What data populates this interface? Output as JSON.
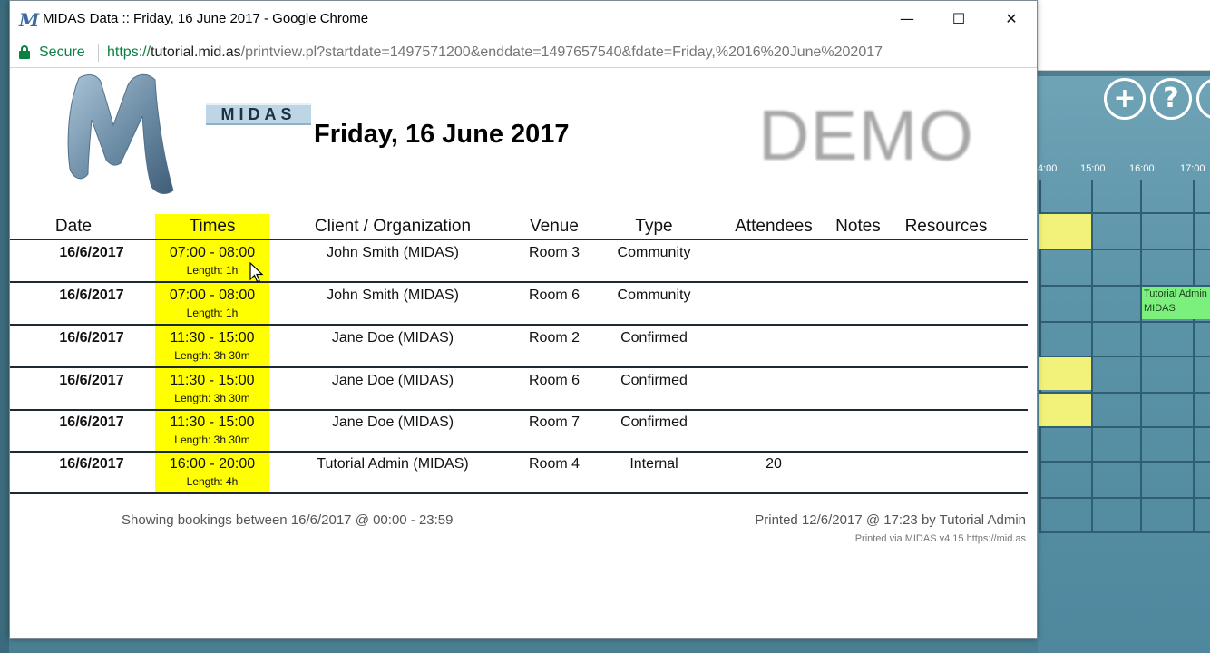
{
  "window": {
    "title": "MIDAS Data :: Friday, 16 June 2017 - Google Chrome",
    "controls": {
      "minimize": "—",
      "maximize": "☐",
      "close": "✕"
    }
  },
  "address_bar": {
    "security_label": "Secure",
    "url_scheme": "https://",
    "url_host": "tutorial.mid.as",
    "url_path": "/printview.pl?startdate=1497571200&enddate=1497657540&fdate=Friday,%2016%20June%202017"
  },
  "logo": {
    "text": "MIDAS"
  },
  "page": {
    "title": "Friday, 16 June 2017",
    "watermark": "DEMO"
  },
  "table": {
    "columns": [
      "Date",
      "Times",
      "Client / Organization",
      "Venue",
      "Type",
      "Attendees",
      "Notes",
      "Resources"
    ],
    "rows": [
      {
        "date": "16/6/2017",
        "time": "07:00 - 08:00",
        "length": "Length: 1h",
        "client": "John Smith (MIDAS)",
        "venue": "Room 3",
        "type": "Community",
        "attendees": "",
        "notes": "",
        "resources": ""
      },
      {
        "date": "16/6/2017",
        "time": "07:00 - 08:00",
        "length": "Length: 1h",
        "client": "John Smith (MIDAS)",
        "venue": "Room 6",
        "type": "Community",
        "attendees": "",
        "notes": "",
        "resources": ""
      },
      {
        "date": "16/6/2017",
        "time": "11:30 - 15:00",
        "length": "Length: 3h 30m",
        "client": "Jane Doe (MIDAS)",
        "venue": "Room 2",
        "type": "Confirmed",
        "attendees": "",
        "notes": "",
        "resources": ""
      },
      {
        "date": "16/6/2017",
        "time": "11:30 - 15:00",
        "length": "Length: 3h 30m",
        "client": "Jane Doe (MIDAS)",
        "venue": "Room 6",
        "type": "Confirmed",
        "attendees": "",
        "notes": "",
        "resources": ""
      },
      {
        "date": "16/6/2017",
        "time": "11:30 - 15:00",
        "length": "Length: 3h 30m",
        "client": "Jane Doe (MIDAS)",
        "venue": "Room 7",
        "type": "Confirmed",
        "attendees": "",
        "notes": "",
        "resources": ""
      },
      {
        "date": "16/6/2017",
        "time": "16:00 - 20:00",
        "length": "Length: 4h",
        "client": "Tutorial Admin (MIDAS)",
        "venue": "Room 4",
        "type": "Internal",
        "attendees": "20",
        "notes": "",
        "resources": ""
      }
    ]
  },
  "footer": {
    "range": "Showing bookings between 16/6/2017 @ 00:00 - 23:59",
    "printed": "Printed 12/6/2017 @ 17:23 by Tutorial Admin",
    "credit": "Printed via MIDAS v4.15 https://mid.as"
  },
  "background_app": {
    "buttons": [
      {
        "icon": "plus-icon",
        "glyph": "+"
      },
      {
        "icon": "help-icon",
        "glyph": "?"
      }
    ],
    "hours": [
      "4:00",
      "15:00",
      "16:00",
      "17:00"
    ],
    "booking_label_line1": "Tutorial Admin",
    "booking_label_line2": "MIDAS"
  },
  "colors": {
    "times_highlight": "#ffff00",
    "secure_green": "#0b8043",
    "bg_teal": "#5b93a8",
    "booking_yellow": "#f2f27a",
    "booking_green": "#7cf07c"
  }
}
